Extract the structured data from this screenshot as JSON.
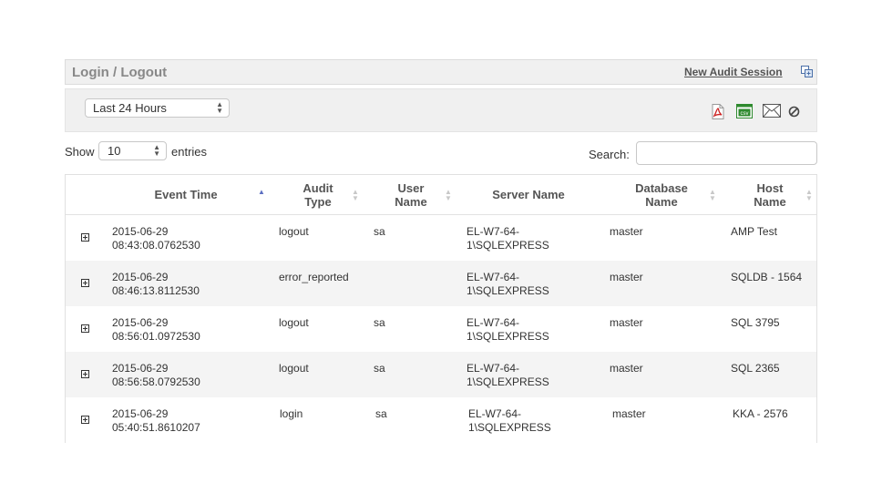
{
  "panel": {
    "title": "Login / Logout",
    "new_session_link": "New Audit Session",
    "copy_icon": "copy-window-icon"
  },
  "toolbar": {
    "time_range": "Last 24 Hours",
    "icons": [
      "pdf-export-icon",
      "csv-export-icon",
      "email-icon",
      "clear-icon"
    ],
    "csv_icon_text": "csv"
  },
  "controls": {
    "show_label": "Show",
    "entries_value": "10",
    "entries_label": "entries",
    "search_label": "Search:",
    "search_value": ""
  },
  "table": {
    "columns": [
      {
        "line1": "Event Time",
        "line2": "",
        "sort": "ascending"
      },
      {
        "line1": "Audit",
        "line2": "Type",
        "sort": "none"
      },
      {
        "line1": "User",
        "line2": "Name",
        "sort": "none"
      },
      {
        "line1": "Server Name",
        "line2": "",
        "sort": "none"
      },
      {
        "line1": "Database",
        "line2": "Name",
        "sort": "none"
      },
      {
        "line1": "Host",
        "line2": "Name",
        "sort": "none"
      }
    ],
    "rows": [
      {
        "date": "2015-06-29",
        "time": "08:43:08.0762530",
        "audit_type": "logout",
        "user": "sa",
        "server_line1": "EL-W7-64-",
        "server_line2": "1\\SQLEXPRESS",
        "database": "master",
        "host": "AMP Test"
      },
      {
        "date": "2015-06-29",
        "time": "08:46:13.8112530",
        "audit_type": "error_reported",
        "user": "",
        "server_line1": "EL-W7-64-",
        "server_line2": "1\\SQLEXPRESS",
        "database": "master",
        "host": "SQLDB - 1564"
      },
      {
        "date": "2015-06-29",
        "time": "08:56:01.0972530",
        "audit_type": "logout",
        "user": "sa",
        "server_line1": "EL-W7-64-",
        "server_line2": "1\\SQLEXPRESS",
        "database": "master",
        "host": "SQL 3795"
      },
      {
        "date": "2015-06-29",
        "time": "08:56:58.0792530",
        "audit_type": "logout",
        "user": "sa",
        "server_line1": "EL-W7-64-",
        "server_line2": "1\\SQLEXPRESS",
        "database": "master",
        "host": "SQL 2365"
      },
      {
        "date": "2015-06-29",
        "time": "05:40:51.8610207",
        "audit_type": "login",
        "user": "sa",
        "server_line1": "EL-W7-64-",
        "server_line2": "1\\SQLEXPRESS",
        "database": "master",
        "host": "KKA - 2576"
      }
    ]
  },
  "colors": {
    "panel_bg": "#f0f0f0",
    "row_alt_bg": "#f4f4f4",
    "sort_active": "#5b6fc2",
    "pdf_red": "#cc2222",
    "csv_green": "#2f8a2f"
  }
}
